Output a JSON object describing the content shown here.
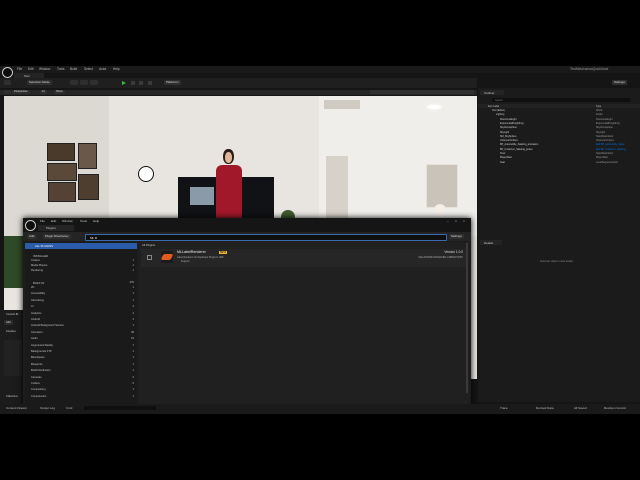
{
  "app": {
    "title": "Test",
    "project_name": "TestMetahumanQuickSand",
    "menu": [
      "File",
      "Edit",
      "Window",
      "Tools",
      "Build",
      "Select",
      "Actor",
      "Help"
    ],
    "mode_label": "Selection Mode",
    "platforms_label": "Platforms",
    "settings_label": "Settings"
  },
  "viewport": {
    "view_buttons": [
      "Perspective",
      "Lit",
      "Show"
    ]
  },
  "outliner": {
    "tab_label": "Outliner",
    "search_placeholder": "Search...",
    "col_item": "Item Label",
    "col_type": "Type",
    "rows": [
      {
        "name": "Test (Editor)",
        "type": "World"
      },
      {
        "name": "Lighting",
        "type": "Folder"
      },
      {
        "name": "DirectionalLight",
        "type": "DirectionalLight"
      },
      {
        "name": "ExponentialHeightFog",
        "type": "ExponentialHeightFog"
      },
      {
        "name": "SkyAtmosphere",
        "type": "SkyAtmosphere"
      },
      {
        "name": "SkyLight",
        "type": "SkyLight"
      },
      {
        "name": "SM_SkySphere",
        "type": "StaticMeshActor"
      },
      {
        "name": "VolumetricCloud",
        "type": "VolumetricCloud"
      },
      {
        "name": "BP_Automobile_Saleting_animation",
        "type": "Edit BP_Automobile_Saleti"
      },
      {
        "name": "BP_Customer_Saleting_poses",
        "type": "Edit BP_Customer_Saleting_"
      },
      {
        "name": "Floor",
        "type": "StaticMeshActor"
      },
      {
        "name": "PlayerStart",
        "type": "PlayerStart"
      },
      {
        "name": "Seat",
        "type": "LevelSequenceActor"
      }
    ]
  },
  "details": {
    "tab_label": "Details",
    "empty_text": "Select an object to view details."
  },
  "plugins_window": {
    "menu": [
      "File",
      "Edit",
      "Window",
      "Tools",
      "Help"
    ],
    "tab_label": "Plugins",
    "add_label": "Add",
    "dirs_label": "Plugin Directories",
    "search_value": "ML R",
    "settings_label": "Settings",
    "all_plugins_label": "ALL PLUGINS",
    "installed_label": "INSTALLED",
    "installed_cats": [
      {
        "name": "Codecs",
        "count": "1"
      },
      {
        "name": "Media Players",
        "count": "1"
      },
      {
        "name": "Rendering",
        "count": "1"
      }
    ],
    "builtin_label": "BUILT-IN",
    "builtin_count": "470",
    "builtin_cats": [
      {
        "name": "2D",
        "count": "1"
      },
      {
        "name": "Accessibility",
        "count": "1"
      },
      {
        "name": "Advertising",
        "count": "1"
      },
      {
        "name": "AI",
        "count": "4"
      },
      {
        "name": "Analytics",
        "count": "4"
      },
      {
        "name": "Android",
        "count": "4"
      },
      {
        "name": "Android Background Service",
        "count": "1"
      },
      {
        "name": "Animation",
        "count": "39"
      },
      {
        "name": "Audio",
        "count": "19"
      },
      {
        "name": "Augmented Reality",
        "count": "7"
      },
      {
        "name": "Backgrounds FTP",
        "count": "1"
      },
      {
        "name": "Blendspace",
        "count": "1"
      },
      {
        "name": "Blueprints",
        "count": "1"
      },
      {
        "name": "Build Distribution",
        "count": "1"
      },
      {
        "name": "Cameras",
        "count": "2"
      },
      {
        "name": "Codecs",
        "count": "6"
      },
      {
        "name": "Compositing",
        "count": "1"
      },
      {
        "name": "Compression",
        "count": "1"
      }
    ],
    "results_header": "All Plugins",
    "plugin": {
      "name": "MLLabelRenderer",
      "badge": "BETA",
      "description": "Label Renderer for Replicator Plugin in UE5",
      "version": "Version 1.0.0",
      "vendor": "MALAKSHMI ADVANCED LABORATORY",
      "support": "Support"
    }
  },
  "side_strip": {
    "content_label": "Content Br...",
    "add_label": "Add",
    "favorites_label": "Favorites",
    "collections_label": "Collections"
  },
  "status_bar": {
    "items": [
      "Content Drawer",
      "Output Log",
      "Cmd"
    ],
    "right_items": [
      "Trace",
      "Derived Data",
      "All Saved",
      "Revision Control"
    ]
  },
  "colors": {
    "accent": "#0070e0",
    "enabled_green": "#3bbf3b",
    "beta_badge": "#f2b833",
    "selection_blue": "#2a5caa"
  }
}
